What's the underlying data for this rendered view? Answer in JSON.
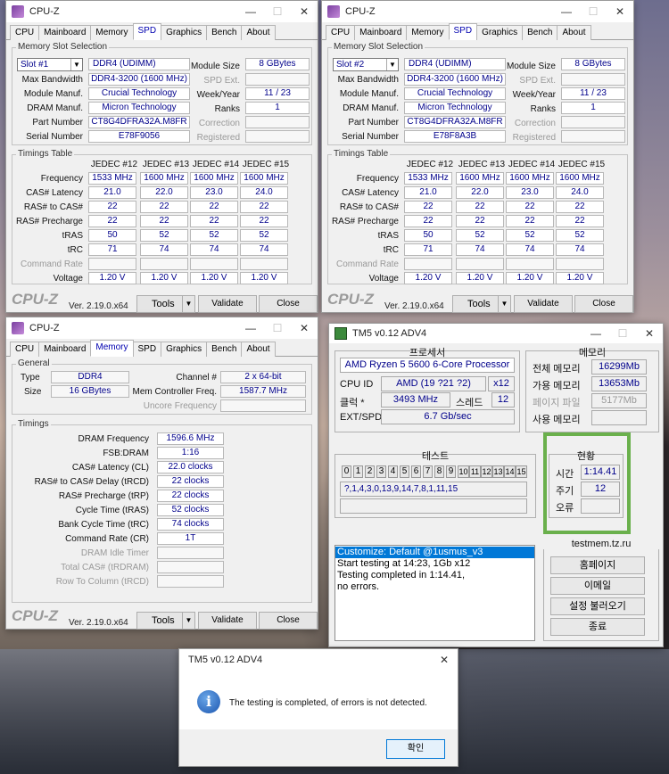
{
  "cpuz": {
    "title": "CPU-Z",
    "logo": "CPU-Z",
    "version": "Ver. 2.19.0.x64",
    "tools": "Tools",
    "validate": "Validate",
    "close": "Close",
    "tabs": [
      "CPU",
      "Mainboard",
      "Memory",
      "SPD",
      "Graphics",
      "Bench",
      "About"
    ]
  },
  "spd": {
    "group": "Memory Slot Selection",
    "timings_group": "Timings Table",
    "labels": {
      "bandwidth": "Max Bandwidth",
      "manuf": "Module Manuf.",
      "dram": "DRAM Manuf.",
      "part": "Part Number",
      "serial": "Serial Number",
      "size": "Module Size",
      "spdext": "SPD Ext.",
      "week": "Week/Year",
      "ranks": "Ranks",
      "correction": "Correction",
      "registered": "Registered"
    },
    "row_labels": [
      "Frequency",
      "CAS# Latency",
      "RAS# to CAS#",
      "RAS# Precharge",
      "tRAS",
      "tRC",
      "Command Rate",
      "Voltage"
    ],
    "columns": [
      "JEDEC #12",
      "JEDEC #13",
      "JEDEC #14",
      "JEDEC #15"
    ],
    "rows": [
      [
        "1533 MHz",
        "1600 MHz",
        "1600 MHz",
        "1600 MHz"
      ],
      [
        "21.0",
        "22.0",
        "23.0",
        "24.0"
      ],
      [
        "22",
        "22",
        "22",
        "22"
      ],
      [
        "22",
        "22",
        "22",
        "22"
      ],
      [
        "50",
        "52",
        "52",
        "52"
      ],
      [
        "71",
        "74",
        "74",
        "74"
      ],
      [
        "",
        "",
        "",
        ""
      ],
      [
        "1.20 V",
        "1.20 V",
        "1.20 V",
        "1.20 V"
      ]
    ],
    "slot1": {
      "slot": "Slot #1",
      "type": "DDR4 (UDIMM)",
      "bandwidth": "DDR4-3200 (1600 MHz)",
      "manuf": "Crucial Technology",
      "dram": "Micron Technology",
      "part": "CT8G4DFRA32A.M8FR",
      "serial": "E78F9056",
      "size": "8 GBytes",
      "week": "11 / 23",
      "ranks": "1"
    },
    "slot2": {
      "slot": "Slot #2",
      "type": "DDR4 (UDIMM)",
      "bandwidth": "DDR4-3200 (1600 MHz)",
      "manuf": "Crucial Technology",
      "dram": "Micron Technology",
      "part": "CT8G4DFRA32A.M8FR",
      "serial": "E78F8A3B",
      "size": "8 GBytes",
      "week": "11 / 23",
      "ranks": "1"
    }
  },
  "mem": {
    "general": "General",
    "timings": "Timings",
    "type_label": "Type",
    "type": "DDR4",
    "size_label": "Size",
    "size": "16 GBytes",
    "channel_label": "Channel #",
    "channel": "2 x 64-bit",
    "mcf_label": "Mem Controller Freq.",
    "mcf": "1587.7 MHz",
    "uncore_label": "Uncore Frequency",
    "t": [
      {
        "l": "DRAM Frequency",
        "v": "1596.6 MHz"
      },
      {
        "l": "FSB:DRAM",
        "v": "1:16"
      },
      {
        "l": "CAS# Latency (CL)",
        "v": "22.0 clocks"
      },
      {
        "l": "RAS# to CAS# Delay (tRCD)",
        "v": "22 clocks"
      },
      {
        "l": "RAS# Precharge (tRP)",
        "v": "22 clocks"
      },
      {
        "l": "Cycle Time (tRAS)",
        "v": "52 clocks"
      },
      {
        "l": "Bank Cycle Time (tRC)",
        "v": "74 clocks"
      },
      {
        "l": "Command Rate (CR)",
        "v": "1T"
      },
      {
        "l": "DRAM Idle Timer",
        "v": ""
      },
      {
        "l": "Total CAS# (tRDRAM)",
        "v": ""
      },
      {
        "l": "Row To Column (tRCD)",
        "v": ""
      }
    ]
  },
  "tm5": {
    "title": "TM5 v0.12 ADV4",
    "proc_title": "프로세서",
    "cpu": "AMD Ryzen 5 5600 6-Core Processor",
    "cpuid_label": "CPU ID",
    "cpuid": "AMD  (19 ?21 ?2)",
    "cpuid_x": "x12",
    "clock_label": "클럭 *",
    "clock": "3493 MHz",
    "thread_label": "스레드",
    "threads": "12",
    "ext_label": "EXT/SPD",
    "ext": "6.7 Gb/sec",
    "mem_title": "메모리",
    "total_label": "전체 메모리",
    "total": "16299Mb",
    "avail_label": "가용 메모리",
    "avail": "13653Mb",
    "page_label": "페이지 파일",
    "page": "5177Mb",
    "used_label": "사용 메모리",
    "used": "",
    "test_title": "테스트",
    "tests": [
      "0",
      "1",
      "2",
      "3",
      "4",
      "5",
      "6",
      "7",
      "8",
      "9",
      "10",
      "11",
      "12",
      "13",
      "14",
      "15"
    ],
    "sequence": "?,1,4,3,0,13,9,14,7,8,1,11,15",
    "status_title": "현황",
    "time_label": "시간",
    "time": "1:14.41",
    "cycle_label": "주기",
    "cycles": "12",
    "error_label": "오류",
    "errors": "",
    "log": [
      "Customize: Default @1usmus_v3",
      "Start testing at 14:23, 1Gb x12",
      "Testing completed in 1:14.41,",
      "no errors."
    ],
    "site": "testmem.tz.ru",
    "btn_home": "홈페이지",
    "btn_email": "이메일",
    "btn_load": "설정 불러오기",
    "btn_exit": "종료"
  },
  "dialog": {
    "title": "TM5 v0.12 ADV4",
    "message": "The testing is completed, of errors is not detected.",
    "ok": "확인"
  },
  "colors": {
    "accent": "#0078d7",
    "value_text": "#00008b",
    "highlight_border": "#6ab04c"
  }
}
